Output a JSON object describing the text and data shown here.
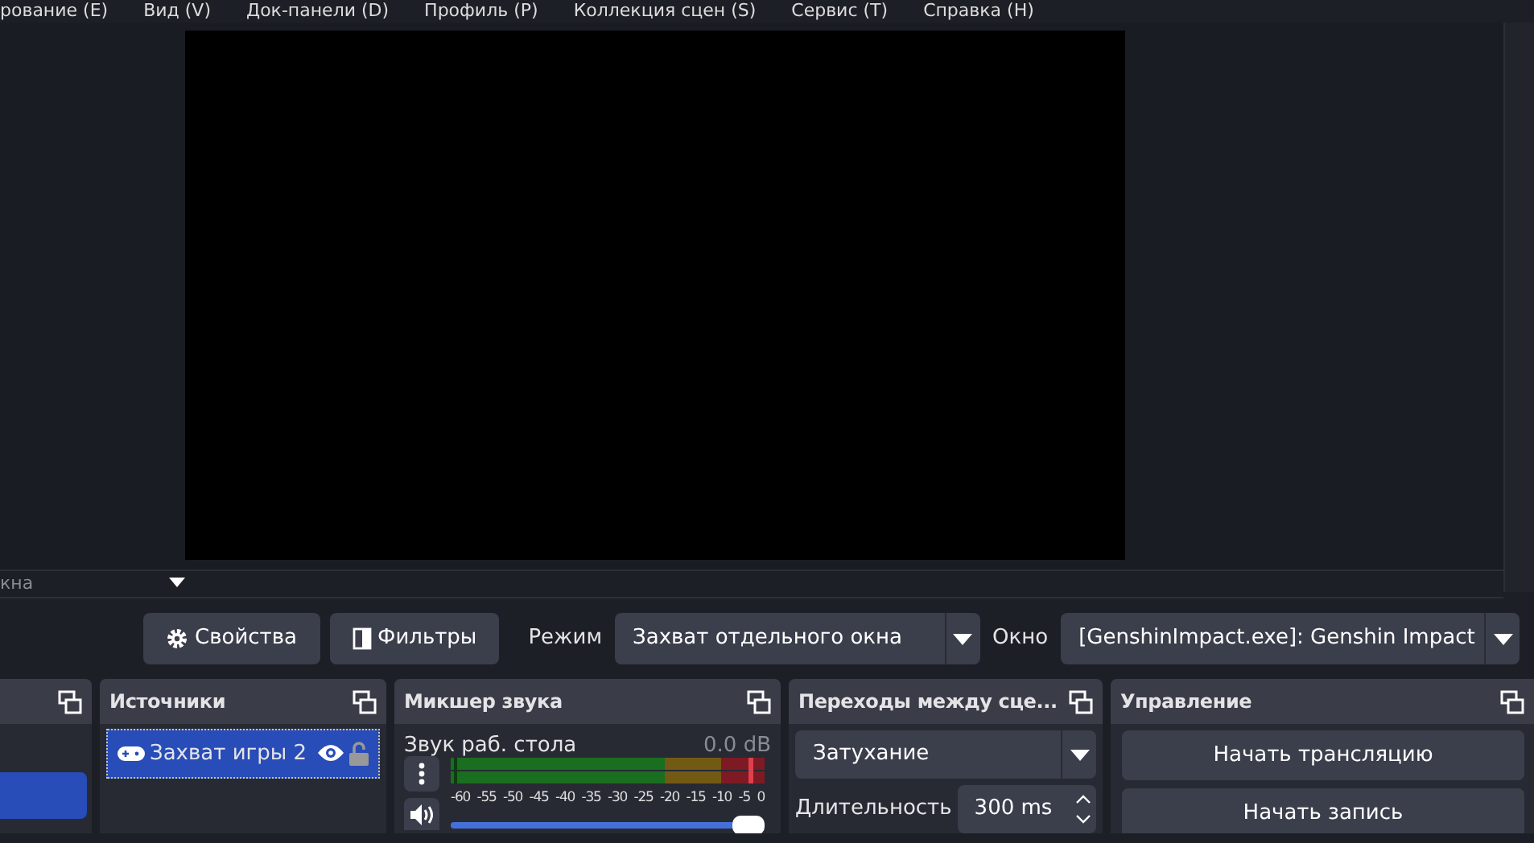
{
  "menu": [
    "рование (E)",
    "Вид (V)",
    "Док-панели (D)",
    "Профиль (P)",
    "Коллекция сцен (S)",
    "Сервис (T)",
    "Справка (H)"
  ],
  "preview": {
    "source_label": "кна"
  },
  "toolbar": {
    "buttons": [
      {
        "label": "Свойства",
        "kind": "gear"
      },
      {
        "label": "Фильтры",
        "kind": "filter"
      }
    ],
    "fields": [
      {
        "label": "Режим",
        "value": "Захват отдельного окна"
      },
      {
        "label": "Окно",
        "value": "[GenshinImpact.exe]: Genshin Impact"
      }
    ]
  },
  "scenes": {
    "items": [
      {
        "selected": true
      }
    ]
  },
  "sources": {
    "title": "Источники",
    "items": [
      {
        "label": "Захват игры 2",
        "selected": true,
        "visible": true,
        "locked": false
      }
    ]
  },
  "mixer": {
    "title": "Микшер звука",
    "channels": [
      {
        "name": "Звук раб. стола",
        "reading": "0.0 dB",
        "level": 1,
        "muted": false,
        "ticks": [
          "-60",
          "-55",
          "-50",
          "-45",
          "-40",
          "-35",
          "-30",
          "-25",
          "-20",
          "-15",
          "-10",
          "-5",
          "0"
        ]
      }
    ]
  },
  "transitions": {
    "title": "Переходы между сце...",
    "value": "Затухание",
    "duration_label": "Длительность",
    "duration": "300 ms"
  },
  "controls": {
    "title": "Управление",
    "buttons": [
      "Начать трансляцию",
      "Начать запись"
    ]
  }
}
